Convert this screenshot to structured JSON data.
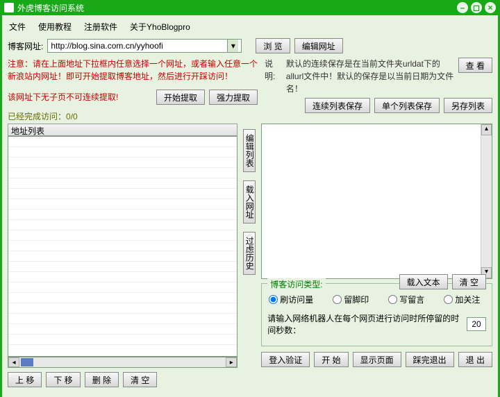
{
  "window": {
    "title": "外虎博客访问系统"
  },
  "menu": {
    "file": "文件",
    "tutorial": "使用教程",
    "register": "注册软件",
    "about": "关于YhoBlogpro"
  },
  "url": {
    "label": "博客网址:",
    "value": "http://blog.sina.com.cn/yyhoofi",
    "browse": "浏 览",
    "edit": "编辑网址"
  },
  "hint": {
    "line1": "注意：请在上面地址下拉框内任意选择一个网址，或者输入任意一个",
    "line2": "新浪站内网址！即可开始提取博客地址，然后进行开踩访问！",
    "nochild": "该网址下无子页不可连续提取!"
  },
  "explain": {
    "label": "说明:",
    "line1": "默认的连续保存是在当前文件夹urldat下的",
    "line2": "allurl文件中！默认的保存是以当前日期为文件名！",
    "view": "查 看"
  },
  "extract": {
    "start": "开始提取",
    "force": "强力提取"
  },
  "save": {
    "cont": "连续列表保存",
    "single": "单个列表保存",
    "saveas": "另存列表"
  },
  "progress": {
    "label": "已经完成访问：",
    "value": "0/0"
  },
  "left": {
    "header": "地址列表",
    "up": "上 移",
    "down": "下 移",
    "del": "删 除",
    "clear": "清 空"
  },
  "mid": {
    "editlist": "编辑列表",
    "loadurl": "载入网址",
    "filter": "过虑历史"
  },
  "right": {
    "loadtext": "载入文本",
    "clear": "清 空",
    "grouptitle": "博客访问类型:",
    "r1": "刷访问量",
    "r2": "留脚印",
    "r3": "写留言",
    "r4": "加关注",
    "delaylabel": "请输入网络机器人在每个网页进行访问时所停留的时间秒数：",
    "delayval": "20",
    "login": "登入验证",
    "start": "开 始",
    "showpage": "显示页面",
    "stop": "踩完退出",
    "exit": "退 出"
  }
}
